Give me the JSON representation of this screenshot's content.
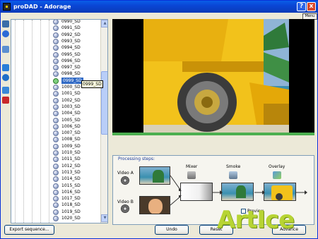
{
  "window": {
    "title": "proDAD - Adorage",
    "help_label": "?",
    "close_label": "x",
    "menu_label": "Menu"
  },
  "tree": {
    "items": [
      "0990_SD",
      "0991_SD",
      "0992_SD",
      "0993_SD",
      "0994_SD",
      "0995_SD",
      "0996_SD",
      "0997_SD",
      "0998_SD",
      "0999_SD",
      "1000_SD",
      "1001_SD",
      "1002_SD",
      "1003_SD",
      "1004_SD",
      "1005_SD",
      "1006_SD",
      "1007_SD",
      "1008_SD",
      "1009_SD",
      "1010_SD",
      "1011_SD",
      "1012_SD",
      "1013_SD",
      "1014_SD",
      "1015_SD",
      "1016_SD",
      "1017_SD",
      "1018_SD",
      "1019_SD",
      "1020_SD"
    ],
    "selected_index": 9,
    "tooltip": "0999_SD"
  },
  "preview": {
    "progress_fraction": 1.0
  },
  "steps": {
    "title": "Processing steps:",
    "video_a": "Video A",
    "video_b": "Video B",
    "mixer": "Mixer",
    "smoke": "Smoke",
    "overlay": "Overlay",
    "preview_label": "Preview",
    "preview_checked": false
  },
  "buttons": {
    "export": "Export sequence...",
    "undo": "Undo",
    "reset": "Reset",
    "advanced": "Advance"
  },
  "watermark": "ArtIce",
  "colors": {
    "title_bar": "#0a46d5",
    "selection": "#316ac5",
    "watermark": "#b7d433"
  }
}
